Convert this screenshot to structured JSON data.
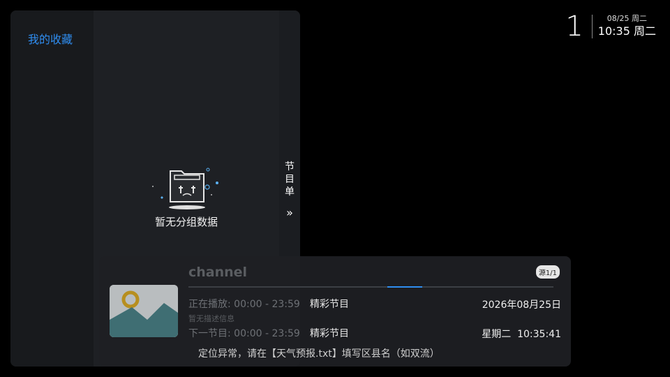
{
  "clock": {
    "channel_number": "1",
    "date": "08/25 周二",
    "time": "10:35 周二"
  },
  "drawer": {
    "groups": [
      {
        "label": "我的收藏",
        "color": "#2f8df0"
      }
    ],
    "empty_text": "暂无分组数据",
    "epg_tab": {
      "label": "节目单",
      "arrow": "»"
    }
  },
  "info": {
    "channel_name": "channel",
    "source": "源1/1",
    "progress": 0.17,
    "current": {
      "label": "正在播放:",
      "time": "00:00 - 23:59",
      "name": "精彩节目"
    },
    "description": "暂无描述信息",
    "next": {
      "label": "下一节目:",
      "time": "00:00 - 23:59",
      "name": "精彩节目"
    },
    "date": "2026年08月25日",
    "weekday_time": "星期二  10:35:41"
  },
  "toast": "定位异常，请在【天气预报.txt】填写区县名（如双流）",
  "colors": {
    "accent": "#2f8df0",
    "thumb_sky": "#b9bdbf",
    "thumb_hill": "#3f6e73",
    "sun": "#b78f1f"
  }
}
